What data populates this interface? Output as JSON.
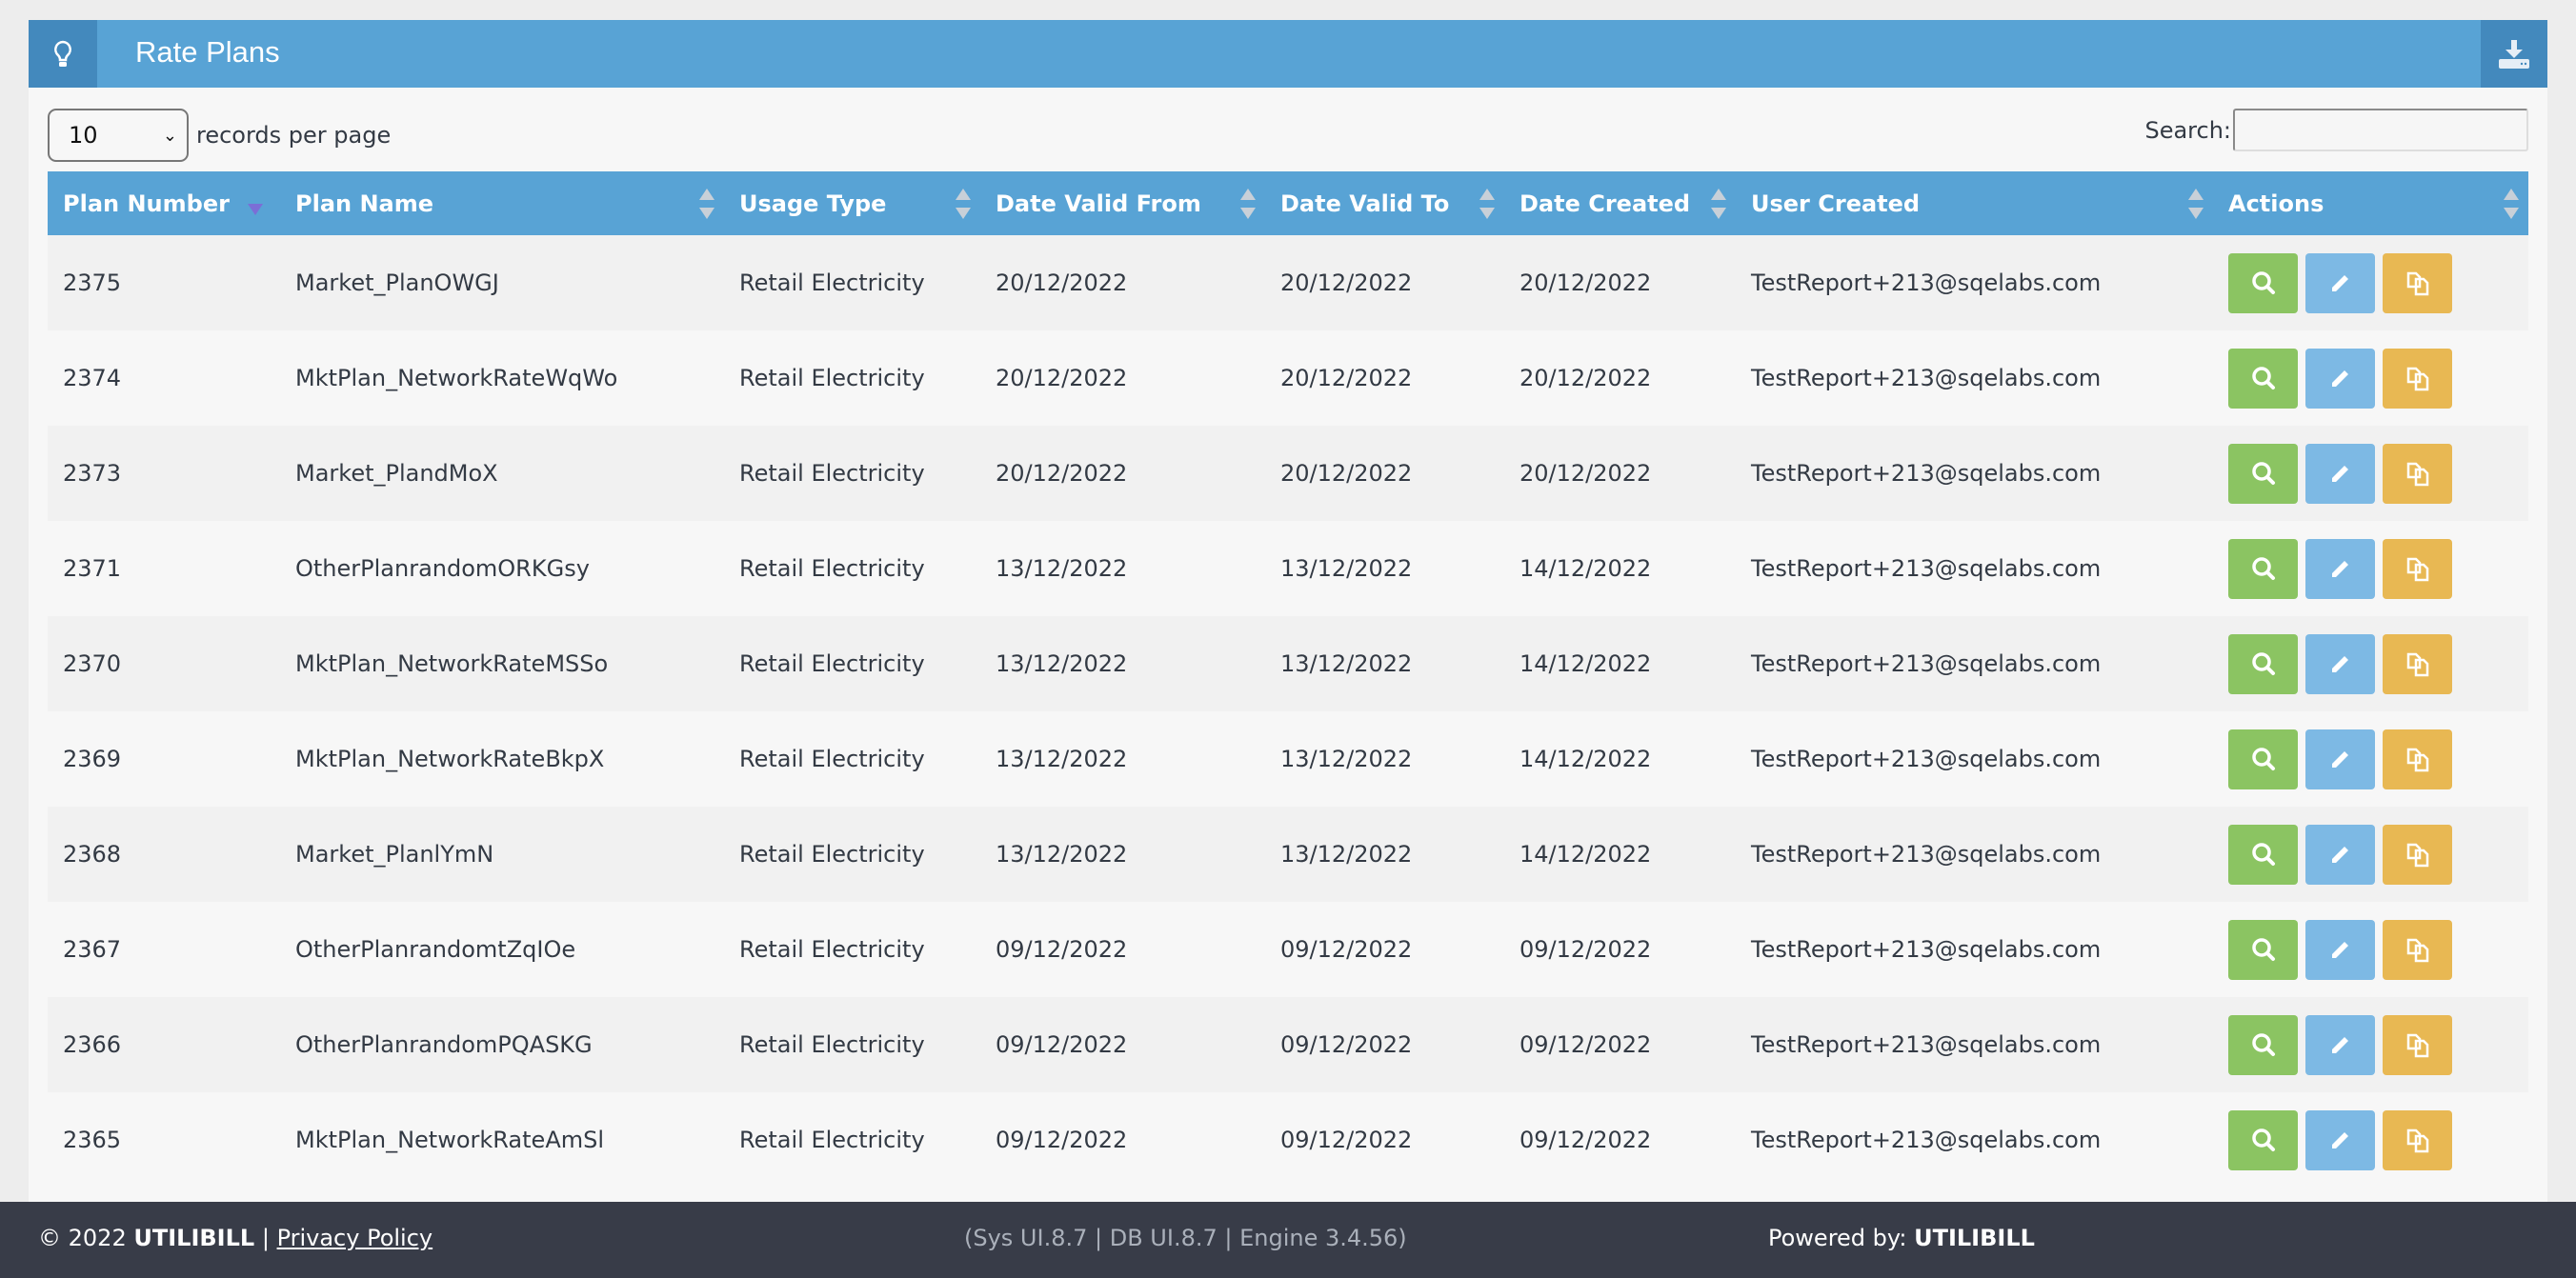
{
  "header": {
    "title": "Rate Plans",
    "icon": "lightbulb-icon",
    "download_icon": "download-icon"
  },
  "controls": {
    "page_size": "10",
    "page_size_label": "records per page",
    "search_label": "Search:",
    "search_value": ""
  },
  "columns": [
    "Plan Number",
    "Plan Name",
    "Usage Type",
    "Date Valid From",
    "Date Valid To",
    "Date Created",
    "User Created",
    "Actions"
  ],
  "rows": [
    [
      "2375",
      "Market_PlanOWGJ",
      "Retail Electricity",
      "20/12/2022",
      "20/12/2022",
      "20/12/2022",
      "TestReport+213@sqelabs.com"
    ],
    [
      "2374",
      "MktPlan_NetworkRateWqWo",
      "Retail Electricity",
      "20/12/2022",
      "20/12/2022",
      "20/12/2022",
      "TestReport+213@sqelabs.com"
    ],
    [
      "2373",
      "Market_PlandMoX",
      "Retail Electricity",
      "20/12/2022",
      "20/12/2022",
      "20/12/2022",
      "TestReport+213@sqelabs.com"
    ],
    [
      "2371",
      "OtherPlanrandomORKGsy",
      "Retail Electricity",
      "13/12/2022",
      "13/12/2022",
      "14/12/2022",
      "TestReport+213@sqelabs.com"
    ],
    [
      "2370",
      "MktPlan_NetworkRateMSSo",
      "Retail Electricity",
      "13/12/2022",
      "13/12/2022",
      "14/12/2022",
      "TestReport+213@sqelabs.com"
    ],
    [
      "2369",
      "MktPlan_NetworkRateBkpX",
      "Retail Electricity",
      "13/12/2022",
      "13/12/2022",
      "14/12/2022",
      "TestReport+213@sqelabs.com"
    ],
    [
      "2368",
      "Market_PlanlYmN",
      "Retail Electricity",
      "13/12/2022",
      "13/12/2022",
      "14/12/2022",
      "TestReport+213@sqelabs.com"
    ],
    [
      "2367",
      "OtherPlanrandomtZqIOe",
      "Retail Electricity",
      "09/12/2022",
      "09/12/2022",
      "09/12/2022",
      "TestReport+213@sqelabs.com"
    ],
    [
      "2366",
      "OtherPlanrandomPQASKG",
      "Retail Electricity",
      "09/12/2022",
      "09/12/2022",
      "09/12/2022",
      "TestReport+213@sqelabs.com"
    ],
    [
      "2365",
      "MktPlan_NetworkRateAmSl",
      "Retail Electricity",
      "09/12/2022",
      "09/12/2022",
      "09/12/2022",
      "TestReport+213@sqelabs.com"
    ]
  ],
  "colors": {
    "header": "#58a3d5",
    "view": "#8bc462",
    "edit": "#7db9e4",
    "copy": "#e8b853",
    "footer": "#383c48"
  },
  "footer": {
    "copyright": "© 2022",
    "brand": "UTILIBILL",
    "sep": "|",
    "privacy": "Privacy Policy",
    "versions": "(Sys UI.8.7 | DB UI.8.7 | Engine 3.4.56)",
    "powered_label": "Powered by:",
    "powered_brand": "UTILIBILL"
  }
}
